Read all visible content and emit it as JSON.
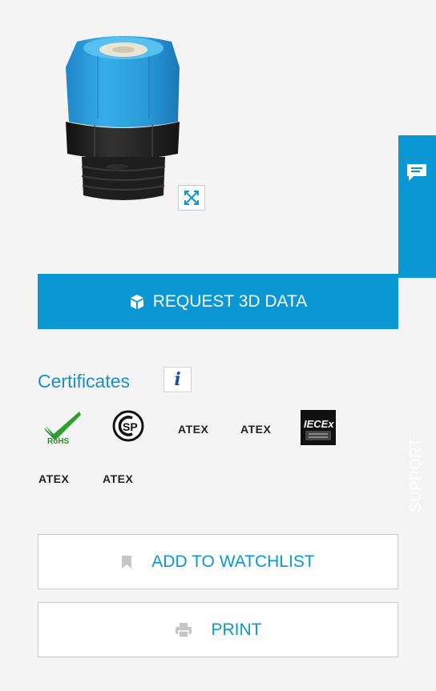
{
  "support": {
    "label": "SUPPORT",
    "icon": "chat-icon"
  },
  "request_3d": {
    "label": "REQUEST 3D DATA",
    "icon": "cube-icon"
  },
  "certificates": {
    "title": "Certificates",
    "info_glyph": "i",
    "logos": [
      {
        "name": "rohs",
        "text": "RoHS"
      },
      {
        "name": "csa",
        "text": "SP"
      },
      {
        "name": "atex-1",
        "text": "ATEX"
      },
      {
        "name": "atex-2",
        "text": "ATEX"
      },
      {
        "name": "iecex",
        "text": "IECEx"
      },
      {
        "name": "atex-3",
        "text": "ATEX"
      },
      {
        "name": "atex-4",
        "text": "ATEX"
      }
    ]
  },
  "watchlist": {
    "label": "ADD TO WATCHLIST",
    "icon": "bookmark-icon"
  },
  "print": {
    "label": "PRINT",
    "icon": "printer-icon"
  },
  "colors": {
    "accent": "#0b96d4",
    "background": "#f4f4f4",
    "cable_gland_blue": "#2aa3e3",
    "cable_gland_black": "#1e1e1e"
  }
}
